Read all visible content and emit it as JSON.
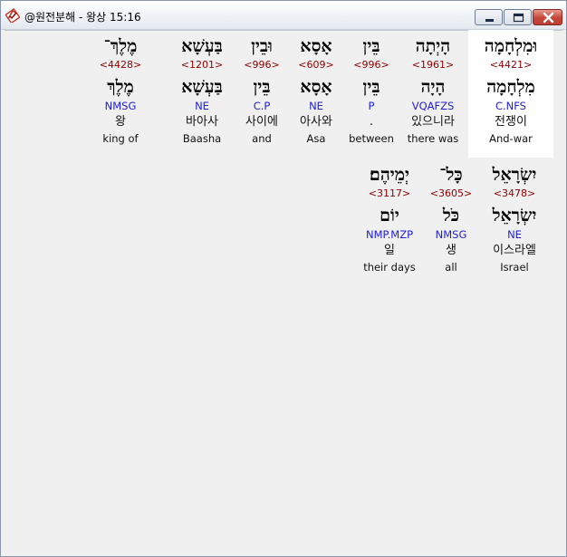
{
  "window": {
    "title": "@원전분해 - 왕상 15:16",
    "icon": "app-book-check-icon",
    "controls": [
      "minimize-icon",
      "maximize-icon",
      "close-icon"
    ]
  },
  "colors": {
    "strong_number": "#8b0000",
    "morphology": "#1f1fcf",
    "highlight": "#ffffff"
  },
  "words": [
    {
      "surface": "וּמִלְחָמָה",
      "strong": "<4421>",
      "lemma": "מִלְחָמָה",
      "morph": "C.NFS",
      "korean": "전쟁이",
      "english": "And-war",
      "highlighted": true
    },
    {
      "surface": "הָיְתָה",
      "strong": "<1961>",
      "lemma": "הָיָה",
      "morph": "VQAFZS",
      "korean": "있으니라",
      "english": "there was"
    },
    {
      "surface": "בֵּין",
      "strong": "<996>",
      "lemma": "בֵּין",
      "morph": "P",
      "korean": ".",
      "english": "between"
    },
    {
      "surface": "אָסָא",
      "strong": "<609>",
      "lemma": "אָסָא",
      "morph": "NE",
      "korean": "아사와",
      "english": "Asa"
    },
    {
      "surface": "וּבֵין",
      "strong": "<996>",
      "lemma": "בֵּין",
      "morph": "C.P",
      "korean": "사이에",
      "english": "and"
    },
    {
      "surface": "בַּעְשָׁא",
      "strong": "<1201>",
      "lemma": "בַּעְשָׁא",
      "morph": "NE",
      "korean": "바아사",
      "english": "Baasha"
    },
    {
      "surface": "מֶלֶךְ־",
      "strong": "<4428>",
      "lemma": "מֶלֶךְ",
      "morph": "NMSG",
      "korean": "왕",
      "english": "king of"
    },
    {
      "surface": "יִשְׂרָאֵל",
      "strong": "<3478>",
      "lemma": "יִשְׂרָאֵל",
      "morph": "NE",
      "korean": "이스라엘",
      "english": "Israel"
    },
    {
      "surface": "כָּל־",
      "strong": "<3605>",
      "lemma": "כֹּל",
      "morph": "NMSG",
      "korean": "생",
      "english": "all"
    },
    {
      "surface": "יְמֵיהֶם׃",
      "strong": "<3117>",
      "lemma": "יוֹם",
      "morph": "NMP.MZP",
      "korean": "일",
      "english": "their days"
    }
  ]
}
